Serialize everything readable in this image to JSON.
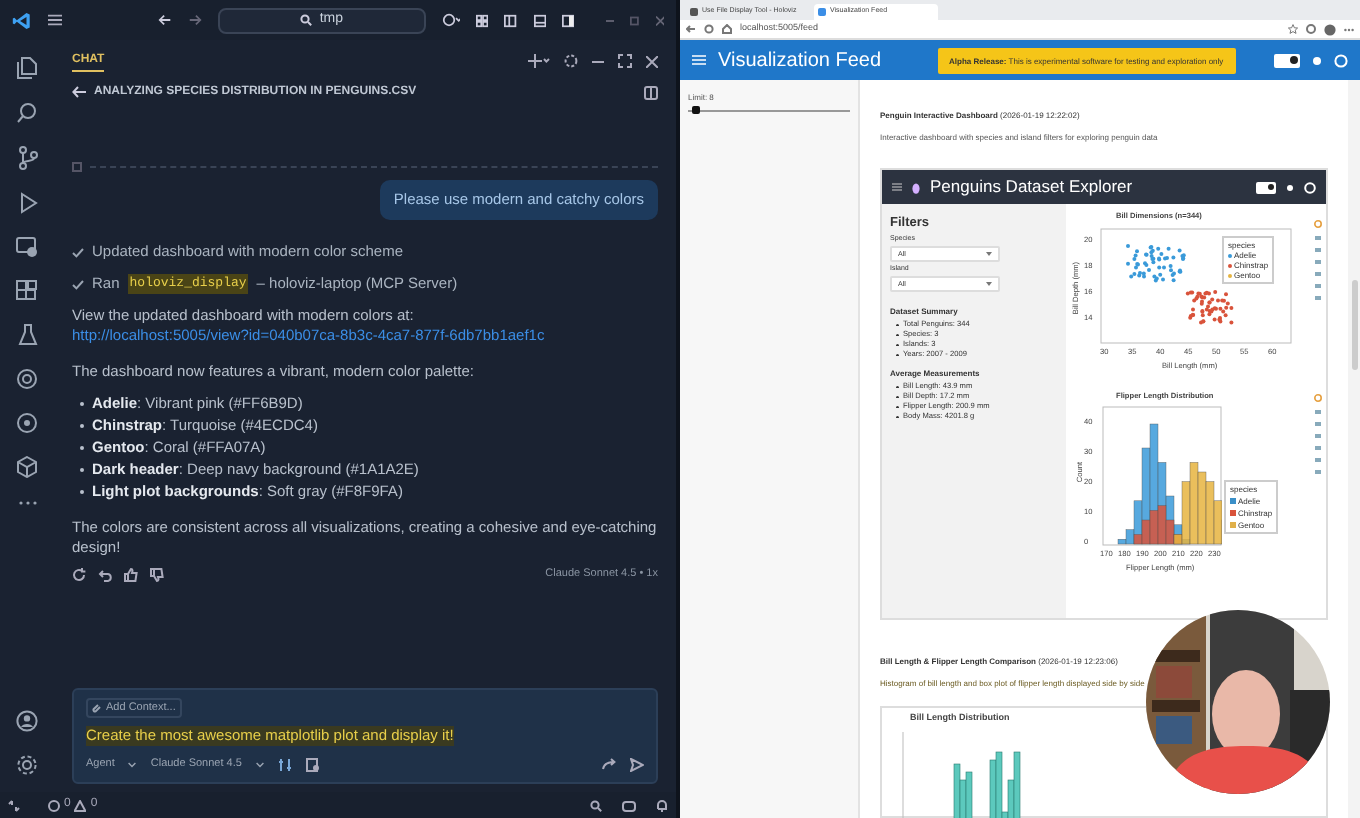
{
  "titlebar": {
    "search": "tmp"
  },
  "chat": {
    "tab": "CHAT",
    "title": "ANALYZING SPECIES DISTRIBUTION IN PENGUINS.CSV",
    "user_message": "Please use modern and catchy colors",
    "steps": [
      {
        "kind": "text",
        "text": "Updated dashboard with modern color scheme"
      },
      {
        "kind": "tool",
        "prefix": "Ran",
        "code": "holoviz_display",
        "suffix": "– holoviz-laptop (MCP Server)"
      }
    ],
    "intro": "View the updated dashboard with modern colors at:",
    "link": "http://localhost:5005/view?id=040b07ca-8b3c-4ca7-877f-6db7bb1aef1c",
    "palette_intro": "The dashboard now features a vibrant, modern color palette:",
    "palette": [
      "**Adelie**: Vibrant pink (#FF6B9D)",
      "**Chinstrap**: Turquoise (#4ECDC4)",
      "**Gentoo**: Coral (#FFA07A)",
      "**Dark header**: Deep navy background (#1A1A2E)",
      "**Light plot backgrounds**: Soft gray (#F8F9FA)"
    ],
    "closing": "The colors are consistent across all visualizations, creating a cohesive and eye-catching design!",
    "model_note": "Claude Sonnet 4.5 • 1x"
  },
  "input": {
    "add_context": "Add Context...",
    "value": "Create the most awesome matplotlib plot and display it!",
    "mode": "Agent",
    "model": "Claude Sonnet 4.5"
  },
  "status_bar": {
    "errors": "0",
    "warnings": "0"
  },
  "browser": {
    "tabs": [
      {
        "title": "Use File Display Tool - Holoviz",
        "selected": false
      },
      {
        "title": "Visualization Feed",
        "selected": true
      }
    ],
    "url": "localhost:5005/feed",
    "app_title": "Visualization Feed",
    "theme_toggle_on": true,
    "banner": "**Alpha Release:** This is experimental software for testing and exploration only",
    "slider": {
      "label": "Limit: 8",
      "level": 0.02
    },
    "feed": [
      {
        "title": "**Penguin Interactive Dashboard** (2026-01-19 12:22:02)",
        "description": "Interactive dashboard with species and island filters for exploring penguin data",
        "dashboard": {
          "title": "Penguins Dataset Explorer",
          "theme_toggle_on": true,
          "filters_title": "Filters",
          "filters": [
            {
              "label": "Species",
              "value": "All"
            },
            {
              "label": "Island",
              "value": "All"
            }
          ],
          "summary_title": "Dataset Summary",
          "summary": [
            "Total Penguins: 344",
            "Species: 3",
            "Islands: 3",
            "Years: 2007 - 2009"
          ],
          "averages_title": "Average Measurements",
          "averages": [
            "Bill Length: 43.9 mm",
            "Bill Depth: 17.2 mm",
            "Flipper Length: 200.9 mm",
            "Body Mass: 4201.8 g"
          ],
          "scatter": {
            "title": "Bill Dimensions (n=344)",
            "xlabel": "Bill Length (mm)",
            "ylabel": "Bill Depth (mm)",
            "xticks": [
              "30",
              "35",
              "40",
              "45",
              "50",
              "55",
              "60"
            ],
            "yticks": [
              "20",
              "18",
              "16",
              "14"
            ],
            "legend_title": "species",
            "legend": [
              "Adelie",
              "Chinstrap",
              "Gentoo"
            ]
          },
          "histogram": {
            "title": "Flipper Length Distribution",
            "xlabel": "Flipper Length (mm)",
            "ylabel": "Count",
            "xticks": [
              "170",
              "180",
              "190",
              "200",
              "210",
              "220",
              "230"
            ],
            "yticks": [
              "40",
              "30",
              "20",
              "10",
              "0"
            ],
            "legend_title": "species",
            "legend": [
              {
                "label": "Adelie",
                "color": "#3a8fc8"
              },
              {
                "label": "Chinstrap",
                "color": "#d9533b"
              },
              {
                "label": "Gentoo",
                "color": "#e0b04a"
              }
            ]
          }
        }
      },
      {
        "title": "**Bill Length & Flipper Length Comparison** (2026-01-19 12:23:06)",
        "description": "Histogram of bill length and box plot of flipper length displayed side by side",
        "chart_title": "Bill Length Distribution"
      }
    ]
  }
}
